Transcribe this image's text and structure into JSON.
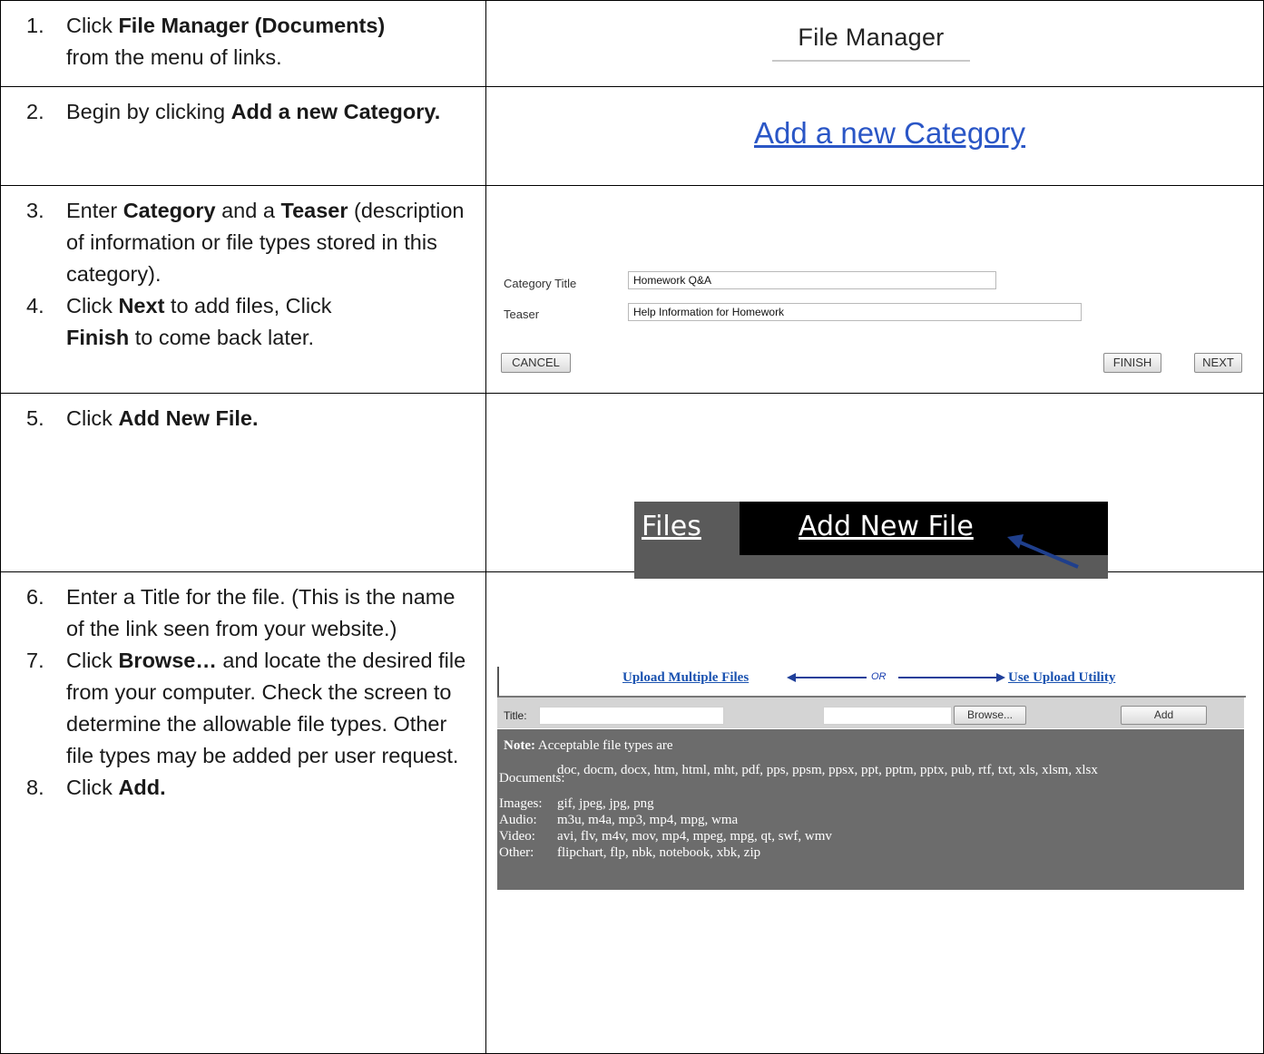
{
  "steps": {
    "s1": {
      "num": "1.",
      "pre": "Click ",
      "bold": "File Manager (Documents)",
      "post": " from the menu of links."
    },
    "s2": {
      "num": "2.",
      "pre": "Begin by clicking ",
      "bold": "Add a new Category."
    },
    "s3": {
      "num": "3.",
      "pre": "Enter ",
      "bold1": "Category",
      "mid": " and a ",
      "bold2": "Teaser",
      "post": " (description of information or file types stored in this category)."
    },
    "s4": {
      "num": "4.",
      "pre": "Click ",
      "bold1": "Next",
      "mid": " to add files, Click ",
      "bold2": "Finish",
      "post": " to come back later."
    },
    "s5": {
      "num": "5.",
      "pre": "Click ",
      "bold": "Add New File."
    },
    "s6": {
      "num": "6.",
      "text": "Enter a Title for the file. (This is the name of the link seen from your website.)"
    },
    "s7": {
      "num": "7.",
      "pre": "Click ",
      "bold": "Browse…",
      "post": " and locate the desired file from your computer. Check the screen to determine the allowable file types. Other file types may be added per user request."
    },
    "s8": {
      "num": "8.",
      "pre": "Click ",
      "bold": "Add."
    }
  },
  "file_manager": {
    "title": "File Manager"
  },
  "category_link": {
    "label": "Add a new Category"
  },
  "category_form": {
    "title_label": "Category Title",
    "title_value": "Homework Q&A",
    "teaser_label": "Teaser",
    "teaser_value": "Help Information for Homework",
    "cancel": "CANCEL",
    "finish": "FINISH",
    "next": "NEXT"
  },
  "files_bar": {
    "files_tab": "Files",
    "add_tab": "Add New File"
  },
  "upload": {
    "multiple_link": "Upload Multiple Files",
    "or": "OR",
    "utility_link": "Use Upload Utility",
    "title_label": "Title:",
    "title_value": "",
    "browse": "Browse...",
    "add": "Add",
    "note_bold": "Note:",
    "note_text": " Acceptable file types are",
    "types": [
      {
        "key": "Documents:",
        "value": "doc, docm, docx, htm, html, mht, pdf, pps, ppsm, ppsx, ppt, pptm, pptx, pub, rtf, txt, xls, xlsm, xlsx"
      },
      {
        "key": "Images:",
        "value": "gif, jpeg, jpg, png"
      },
      {
        "key": "Audio:",
        "value": "m3u, m4a, mp3, mp4, mpg, wma"
      },
      {
        "key": "Video:",
        "value": "avi, flv, m4v, mov, mp4, mpeg, mpg, qt, swf, wmv"
      },
      {
        "key": "Other:",
        "value": "flipchart, flp, nbk, notebook, xbk, zip"
      }
    ]
  },
  "colors": {
    "link_blue": "#2a56c6",
    "notes_bg": "#6c6c6c",
    "bar_bg": "#5a5a5a"
  }
}
